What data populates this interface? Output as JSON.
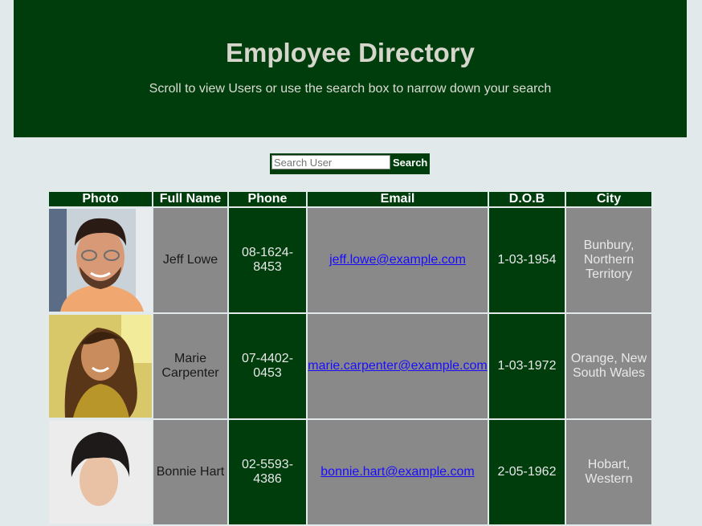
{
  "header": {
    "title": "Employee Directory",
    "subtitle": "Scroll to view Users or use the search box to narrow down your search"
  },
  "search": {
    "placeholder": "Search User",
    "button_label": "Search"
  },
  "table": {
    "columns": [
      "Photo",
      "Full Name",
      "Phone",
      "Email",
      "D.O.B",
      "City"
    ],
    "rows": [
      {
        "name": "Jeff Lowe",
        "phone": "08-1624-8453",
        "email": "jeff.lowe@example.com",
        "dob": "1-03-1954",
        "city": "Bunbury, Northern Territory"
      },
      {
        "name": "Marie Carpenter",
        "phone": "07-4402-0453",
        "email": "marie.carpenter@example.com",
        "dob": "1-03-1972",
        "city": "Orange, New South Wales"
      },
      {
        "name": "Bonnie Hart",
        "phone": "02-5593-4386",
        "email": "bonnie.hart@example.com",
        "dob": "2-05-1962",
        "city": "Hobart, Western"
      }
    ]
  },
  "colors": {
    "primary_green": "#003d0c",
    "cell_gray": "#898989",
    "page_bg": "#e2e9eb",
    "link": "#1a0dff"
  }
}
